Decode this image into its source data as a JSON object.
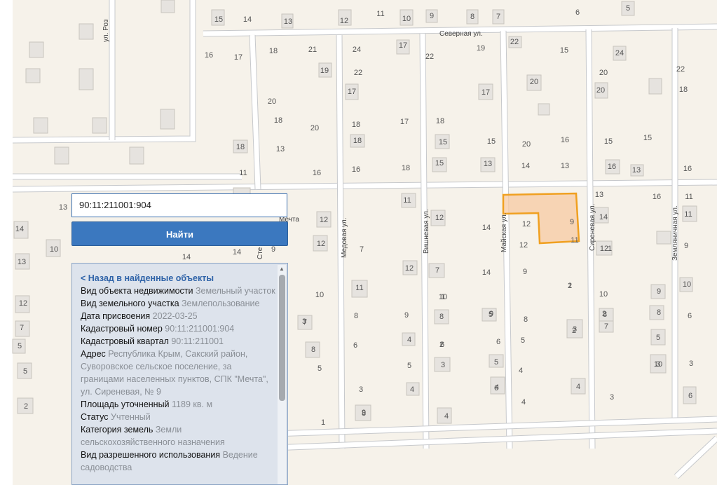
{
  "map": {
    "streets": {
      "severnaya": "Северная ул.",
      "roz": "ул. Роз",
      "medovaya": "Медовая ул.",
      "vishnevaya": "Вишневая ул.",
      "mayskaya": "Майская ул.",
      "sirenevaya": "Сиреневая ул.",
      "zemlyanichnaya": "Земляничная ул.",
      "ste": "Сте"
    },
    "area_label": "Мечта",
    "house_numbers": [
      "15",
      "14",
      "13",
      "12",
      "11",
      "10",
      "9",
      "8",
      "7",
      "6",
      "5",
      "16",
      "17",
      "18",
      "21",
      "24",
      "17",
      "22",
      "19",
      "22",
      "15",
      "24",
      "22",
      "19",
      "22",
      "20",
      "20",
      "17",
      "17",
      "20",
      "20",
      "18",
      "18",
      "20",
      "18",
      "17",
      "18",
      "15",
      "20",
      "15",
      "18",
      "13",
      "18",
      "15",
      "15",
      "16",
      "16",
      "18",
      "15",
      "13",
      "14",
      "13",
      "16",
      "13",
      "16",
      "11",
      "16",
      "13",
      "16",
      "13",
      "11",
      "14",
      "11",
      "12",
      "14",
      "12",
      "11",
      "14",
      "14",
      "14",
      "9",
      "7",
      "12",
      "12",
      "12",
      "10",
      "13",
      "11",
      "12",
      "14",
      "7",
      "12",
      "9",
      "9",
      "11",
      "12",
      "10",
      "10",
      "9",
      "10",
      "10",
      "8",
      "9",
      "8",
      "9",
      "8",
      "8",
      "8",
      "7",
      "7",
      "7",
      "6",
      "6",
      "6",
      "8",
      "6",
      "4",
      "5",
      "5",
      "5",
      "5",
      "5",
      "5",
      "5",
      "4",
      "3",
      "3",
      "3",
      "3",
      "3",
      "4",
      "4",
      "4",
      "4",
      "3",
      "4",
      "2",
      "1",
      "1",
      "1",
      "2",
      "2",
      "2",
      "2",
      "1",
      "9",
      "10",
      "3",
      "5",
      "6",
      "8",
      "6",
      "2",
      "3",
      "7",
      "7",
      "2",
      "2",
      "1"
    ],
    "parcel_number": "9"
  },
  "search": {
    "value": "90:11:211001:904",
    "button_label": "Найти"
  },
  "panel": {
    "back_link": "< Назад в найденные объекты",
    "fields": [
      {
        "label": "Вид объекта недвижимости",
        "value": "Земельный участок"
      },
      {
        "label": "Вид земельного участка",
        "value": "Землепользование"
      },
      {
        "label": "Дата присвоения",
        "value": "2022-03-25"
      },
      {
        "label": "Кадастровый номер",
        "value": "90:11:211001:904"
      },
      {
        "label": "Кадастровый квартал",
        "value": "90:11:211001"
      },
      {
        "label": "Адрес",
        "value": "Республика Крым, Сакский район, Суворовское сельское поселение, за границами населенных пунктов, СПК \"Мечта\", ул. Сиреневая, № 9"
      },
      {
        "label": "Площадь уточненный",
        "value": "1189 кв. м"
      },
      {
        "label": "Статус",
        "value": "Учтенный"
      },
      {
        "label": "Категория земель",
        "value": "Земли сельскохозяйственного назначения"
      },
      {
        "label": "Вид разрешенного использования",
        "value": "Ведение садоводства"
      }
    ]
  }
}
